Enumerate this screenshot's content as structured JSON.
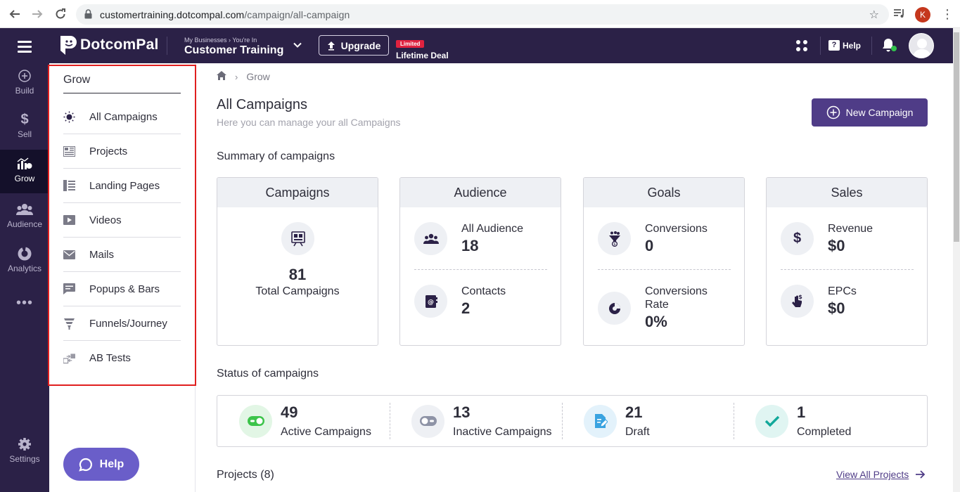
{
  "browser": {
    "url_host": "customertraining.dotcompal.com",
    "url_path": "/campaign/all-campaign",
    "profile_initial": "K"
  },
  "header": {
    "brand": "DotcomPal",
    "business_crumb": "My Businesses › You're In",
    "business_name": "Customer Training",
    "upgrade_label": "Upgrade",
    "deal_badge": "Limited",
    "deal_text": "Lifetime Deal",
    "help_label": "Help"
  },
  "rail": {
    "items": [
      {
        "label": "Build",
        "icon": "plus-circle-icon"
      },
      {
        "label": "Sell",
        "icon": "dollar-icon"
      },
      {
        "label": "Grow",
        "icon": "growth-icon",
        "active": true
      },
      {
        "label": "Audience",
        "icon": "people-icon"
      },
      {
        "label": "Analytics",
        "icon": "donut-icon"
      },
      {
        "label": "Settings",
        "icon": "gear-icon"
      }
    ],
    "more": "•••"
  },
  "subnav": {
    "title": "Grow",
    "items": [
      {
        "label": "All Campaigns",
        "icon": "bulb-icon"
      },
      {
        "label": "Projects",
        "icon": "projects-icon"
      },
      {
        "label": "Landing Pages",
        "icon": "landing-page-icon"
      },
      {
        "label": "Videos",
        "icon": "video-icon"
      },
      {
        "label": "Mails",
        "icon": "mail-icon"
      },
      {
        "label": "Popups & Bars",
        "icon": "chat-icon"
      },
      {
        "label": "Funnels/Journey",
        "icon": "funnel-icon"
      },
      {
        "label": "AB Tests",
        "icon": "ab-test-icon"
      }
    ],
    "help_button": "Help"
  },
  "main": {
    "breadcrumb": {
      "current": "Grow"
    },
    "title": "All Campaigns",
    "subtitle": "Here you can manage your all Campaigns",
    "new_campaign": "New Campaign",
    "summary_heading": "Summary of campaigns",
    "cards": {
      "campaigns": {
        "title": "Campaigns",
        "value": "81",
        "label": "Total Campaigns"
      },
      "audience": {
        "title": "Audience",
        "m1_label": "All Audience",
        "m1_value": "18",
        "m2_label": "Contacts",
        "m2_value": "2"
      },
      "goals": {
        "title": "Goals",
        "m1_label": "Conversions",
        "m1_value": "0",
        "m2_label": "Conversions Rate",
        "m2_value": "0%"
      },
      "sales": {
        "title": "Sales",
        "m1_label": "Revenue",
        "m1_value": "$0",
        "m2_label": "EPCs",
        "m2_value": "$0"
      }
    },
    "status_heading": "Status of campaigns",
    "status": [
      {
        "value": "49",
        "label": "Active Campaigns",
        "color": "#3cc44a"
      },
      {
        "value": "13",
        "label": "Inactive Campaigns",
        "color": "#8e93a6"
      },
      {
        "value": "21",
        "label": "Draft",
        "color": "#3aa3e0"
      },
      {
        "value": "1",
        "label": "Completed",
        "color": "#12a89a"
      }
    ],
    "projects_heading": "Projects (8)",
    "view_all": "View All Projects"
  },
  "colors": {
    "brand_dark": "#2b2147",
    "accent": "#4f3c87",
    "highlight_frame": "#e01f1f"
  }
}
